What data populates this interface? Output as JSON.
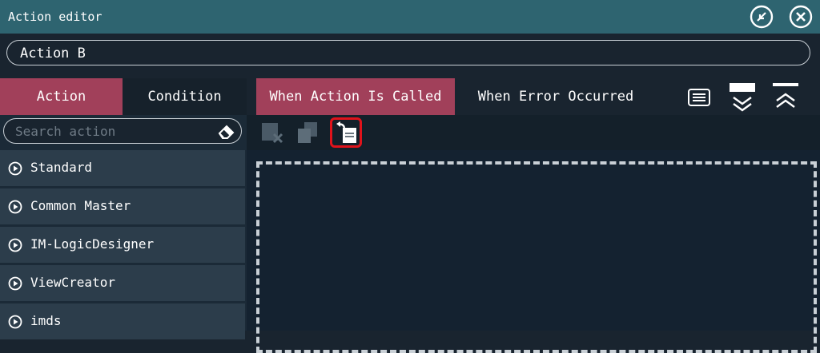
{
  "window": {
    "title": "Action editor",
    "icons": {
      "restore": "collapse-arrows-icon",
      "close": "close-circle-icon"
    }
  },
  "action_name": {
    "value": "Action B"
  },
  "left_tabs": {
    "action": "Action",
    "condition": "Condition",
    "active": "Action"
  },
  "search": {
    "placeholder": "Search action",
    "value": ""
  },
  "categories": [
    {
      "label": "Standard"
    },
    {
      "label": "Common Master"
    },
    {
      "label": "IM-LogicDesigner"
    },
    {
      "label": "ViewCreator"
    },
    {
      "label": "imds"
    }
  ],
  "event_tabs": {
    "called": "When Action Is Called",
    "error": "When Error Occurred",
    "active": "When Action Is Called"
  },
  "toolbar_icons": [
    "delete-icon",
    "copy-icon",
    "paste-icon"
  ],
  "colors": {
    "accent": "#a1405a",
    "titlebar": "#2e6470",
    "highlight": "#e0131b"
  }
}
